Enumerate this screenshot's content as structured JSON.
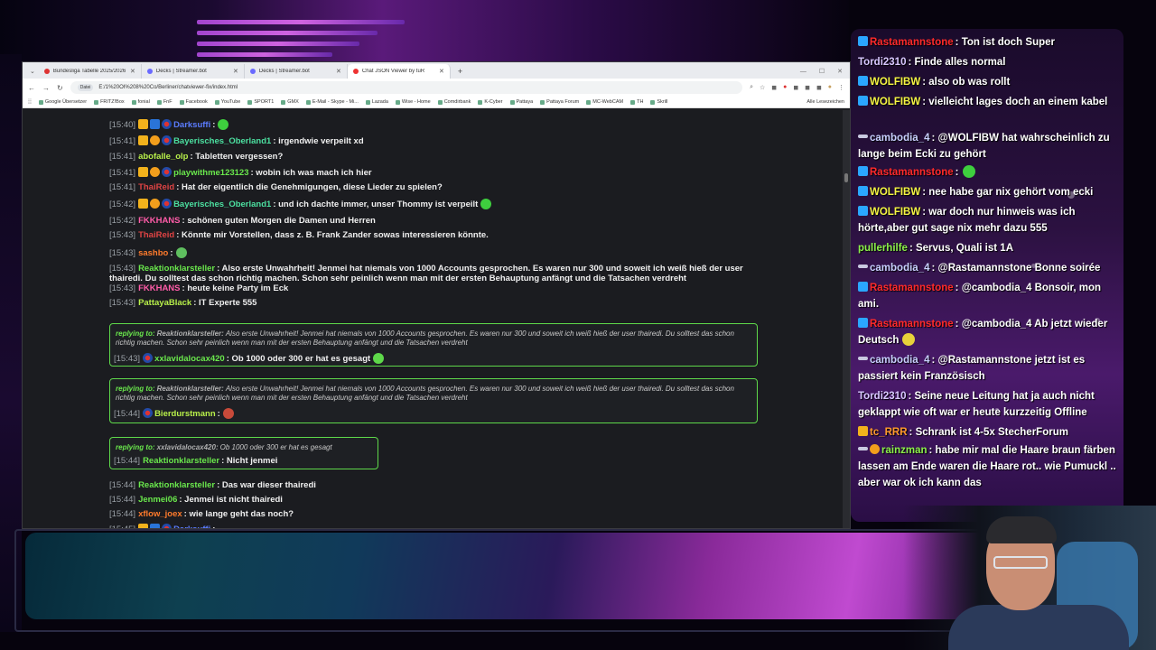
{
  "browser": {
    "tabs": [
      {
        "label": "Bundesliga Tabelle 2025/2026",
        "active": false
      },
      {
        "label": "Decks | Streamer.bot",
        "active": false
      },
      {
        "label": "Decks | Streamer.bot",
        "active": false
      },
      {
        "label": "Chat JSON Viewer by tuR",
        "active": true
      }
    ],
    "url_chip": "Datei",
    "url": "E:/1%20OI%208%20Co/Berliner/chatviewer-fix/index.html",
    "bookmarks": [
      "Google Übersetzer",
      "FRITZ!Box",
      "fonial",
      "FnF",
      "Facebook",
      "YouTube",
      "SPORT1",
      "GMX",
      "E-Mail - Skype - Mi...",
      "Lazada",
      "Wise - Home",
      "Comdirbank",
      "K-Cyber",
      "Pattaya",
      "Pattaya Forum",
      "MC-WebCAM",
      "TH",
      "Skrill"
    ],
    "bookmarks_end": "Alle Lesezeichen"
  },
  "chat": [
    {
      "ts": "[15:40]",
      "name": "Darksuffi",
      "text": ":",
      "color": "blue"
    },
    {
      "ts": "[15:41]",
      "name": "Bayerisches_Oberland1",
      "text": ": irgendwie verpeilt xd",
      "color": "teal"
    },
    {
      "ts": "[15:41]",
      "name": "abofalle_olp",
      "text": ": Tabletten vergessen?",
      "color": "lime"
    },
    {
      "ts": "[15:41]",
      "name": "playwithme123123",
      "text": ": wobin ich was mach ich hier",
      "color": "green"
    },
    {
      "ts": "[15:41]",
      "name": "ThaiReid",
      "text": ": Hat der eigentlich die Genehmigungen, diese Lieder zu spielen?",
      "color": "red"
    },
    {
      "ts": "[15:42]",
      "name": "Bayerisches_Oberland1",
      "text": ": und ich dachte immer, unser Thommy ist verpeilt",
      "color": "teal"
    },
    {
      "ts": "[15:42]",
      "name": "FKKHANS",
      "text": ": schönen guten Morgen die Damen und Herren",
      "color": "pink"
    },
    {
      "ts": "[15:43]",
      "name": "ThaiReid",
      "text": ": Könnte mir Vorstellen, dass z. B. Frank Zander sowas interessieren könnte.",
      "color": "red"
    },
    {
      "ts": "[15:43]",
      "name": "sashbo",
      "text": ":",
      "color": "orange"
    },
    {
      "ts": "[15:43]",
      "name": "Reaktionklarsteller",
      "text": ": Also erste Unwahrheit! Jenmei hat niemals von 1000 Accounts gesprochen. Es waren nur 300 und soweit ich weiß hieß der user thairedi. Du solltest das schon richtig machen. Schon sehr peinlich wenn man mit der ersten Behauptung anfängt und die Tatsachen verdreht",
      "color": "green"
    },
    {
      "ts": "[15:43]",
      "name": "FKKHANS",
      "text": ": heute keine Party im Eck",
      "color": "pink"
    },
    {
      "ts": "[15:43]",
      "name": "PattayaBlack",
      "text": ": IT Experte 555",
      "color": "lime"
    }
  ],
  "replies": [
    {
      "label": "replying to:",
      "quoted_name": "Reaktionklarsteller:",
      "quoted_text": "Also erste Unwahrheit! Jenmei hat niemals von 1000 Accounts gesprochen. Es waren nur 300 und soweit ich weiß hieß der user thairedi. Du solltest das schon richtig machen. Schon sehr peinlich wenn man mit der ersten Behauptung anfängt und die Tatsachen verdreht",
      "ts": "[15:43]",
      "name": "xxlavidalocax420",
      "text": ": Ob 1000 oder 300 er hat es gesagt"
    },
    {
      "label": "replying to:",
      "quoted_name": "Reaktionklarsteller:",
      "quoted_text": "Also erste Unwahrheit! Jenmei hat niemals von 1000 Accounts gesprochen. Es waren nur 300 und soweit ich weiß hieß der user thairedi. Du solltest das schon richtig machen. Schon sehr peinlich wenn man mit der ersten Behauptung anfängt und die Tatsachen verdreht",
      "ts": "[15:44]",
      "name": "Bierdurstmann",
      "text": ":"
    },
    {
      "label": "replying to:",
      "quoted_name": "xxlavidalocax420:",
      "quoted_text": "Ob 1000 oder 300 er hat es gesagt",
      "ts": "[15:44]",
      "name": "Reaktionklarsteller",
      "text": ": Nicht jenmei"
    }
  ],
  "chat_tail": [
    {
      "ts": "[15:44]",
      "name": "Reaktionklarsteller",
      "text": ": Das war dieser thairedi",
      "color": "green"
    },
    {
      "ts": "[15:44]",
      "name": "Jenmei06",
      "text": ": Jenmei ist nicht thairedi",
      "color": "green"
    },
    {
      "ts": "[15:44]",
      "name": "xflow_joex",
      "text": ": wie lange geht das noch?",
      "color": "orange"
    },
    {
      "ts": "[15:45]",
      "name": "Darksuffi",
      "text": ":",
      "color": "blue"
    }
  ],
  "overlay_chat": [
    {
      "name": "Rastamannstone",
      "text": ": Ton ist doch Super",
      "color": "red"
    },
    {
      "name": "Tordi2310",
      "text": ": Finde alles normal",
      "color": "lav"
    },
    {
      "name": "WOLFIBW",
      "text": ": also ob was rollt",
      "color": "yellow"
    },
    {
      "name": "WOLFIBW",
      "text": ": vielleicht lages doch an einem kabel",
      "color": "yellow"
    },
    {
      "name": "cambodia_4",
      "text": ": @WOLFIBW hat wahrscheinlich zu lange beim Ecki zu gehört",
      "color": "blue"
    },
    {
      "name": "Rastamannstone",
      "text": ":",
      "color": "red"
    },
    {
      "name": "WOLFIBW",
      "text": ": nee habe gar nix gehört vom ecki",
      "color": "yellow"
    },
    {
      "name": "WOLFIBW",
      "text": ": war doch nur hinweis was ich hörte,aber gut sage nix mehr dazu 555",
      "color": "yellow"
    },
    {
      "name": "pullerhilfe",
      "text": ": Servus, Quali ist 1A",
      "color": "lime"
    },
    {
      "name": "cambodia_4",
      "text": ": @Rastamannstone Bonne soirée",
      "color": "blue"
    },
    {
      "name": "Rastamannstone",
      "text": ": @cambodia_4 Bonsoir, mon ami.",
      "color": "red"
    },
    {
      "name": "Rastamannstone",
      "text": ": @cambodia_4 Ab jetzt wieder Deutsch",
      "color": "red"
    },
    {
      "name": "cambodia_4",
      "text": ": @Rastamannstone jetzt ist es passiert kein Französisch",
      "color": "blue"
    },
    {
      "name": "Tordi2310",
      "text": ": Seine neue Leitung hat ja auch nicht geklappt wie oft war er heute kurzzeitig Offline",
      "color": "lav"
    },
    {
      "name": "tc_RRR",
      "text": ": Schrank ist 4-5x StecherForum",
      "color": "orange"
    },
    {
      "name": "rainzman",
      "text": ": habe mir mal die Haare braun färben lassen am Ende waren die Haare rot.. wie Pumuckl .. aber war ok ich kann das",
      "color": "lime"
    }
  ],
  "colors": {
    "reply_border": "#5ed84a",
    "accent_purple": "#b14be0"
  }
}
